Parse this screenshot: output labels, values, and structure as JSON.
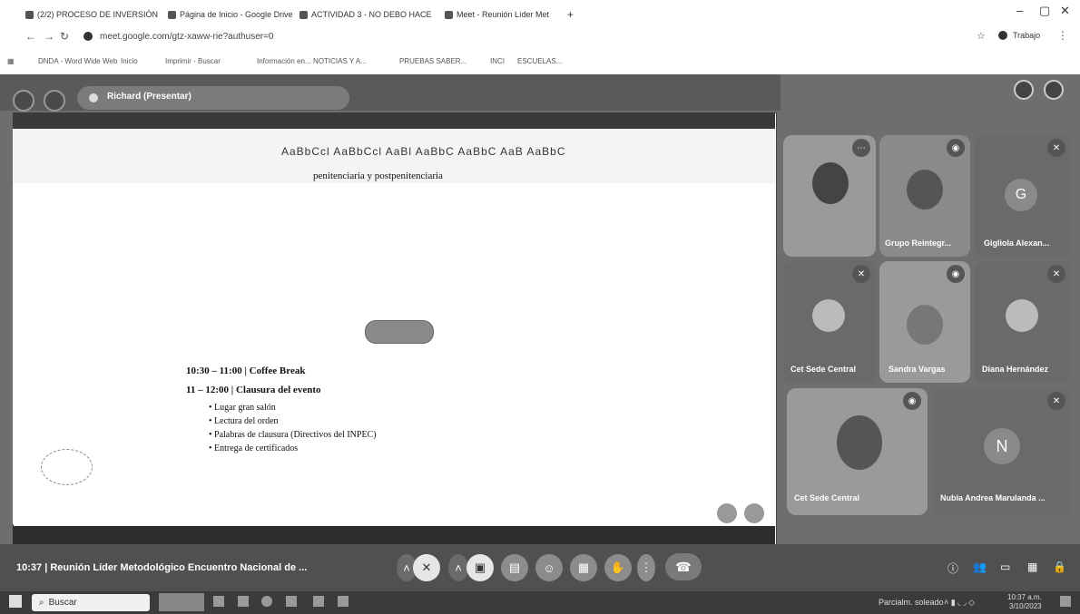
{
  "browser": {
    "tabs": [
      "(2/2) PROCESO DE INVERSIÓN",
      "Página de Inicio - Google Drive",
      "ACTIVIDAD 3 - NO DEBO HACE",
      "Meet - Reunión Líder Met"
    ],
    "url": "meet.google.com/gtz-xaww-rie?authuser=0",
    "profile_label": "Trabajo",
    "bookmarks": [
      "DNDA - Word Wide Web",
      "Inicio",
      "Imprimir - Buscar",
      "Información en...",
      "NOTICIAS Y A...",
      "PRUEBAS SABER...",
      "INCI",
      "ESCUELAS..."
    ]
  },
  "meet": {
    "presenter": "Richard (Presentar)",
    "time": "10:37",
    "meeting_title": "Reunión Líder Metodológico Encuentro Nacional de ...",
    "participants": [
      {
        "name": "",
        "initial": ""
      },
      {
        "name": "Grupo Reintegr...",
        "initial": ""
      },
      {
        "name": "Gigliola Alexan...",
        "initial": "G"
      },
      {
        "name": "Cet Sede Central",
        "initial": ""
      },
      {
        "name": "Sandra Vargas",
        "initial": ""
      },
      {
        "name": "Diana Hernández",
        "initial": ""
      },
      {
        "name": "Cet Sede Central",
        "initial": ""
      },
      {
        "name": "Nubia Andrea Marulanda ...",
        "initial": "N"
      }
    ]
  },
  "shared_doc": {
    "ribbon_styles": "AaBbCcl  AaBbCcl  AaBl  AaBbC  AaBbC  AaB  AaBbC",
    "top_line": "penitenciaria y postpenitenciaria",
    "coffee": "10:30 – 11:00 | Coffee Break",
    "closing_heading": "11 – 12:00 | Clausura del evento",
    "bullets": [
      "Lugar gran salón",
      "Lectura del orden",
      "Palabras de clausura (Directivos del INPEC)",
      "Entrega de certificados"
    ]
  },
  "taskbar": {
    "search_placeholder": "Buscar",
    "weather": "Parcialm. soleado",
    "time": "10:37 a.m.",
    "date": "3/10/2023"
  }
}
